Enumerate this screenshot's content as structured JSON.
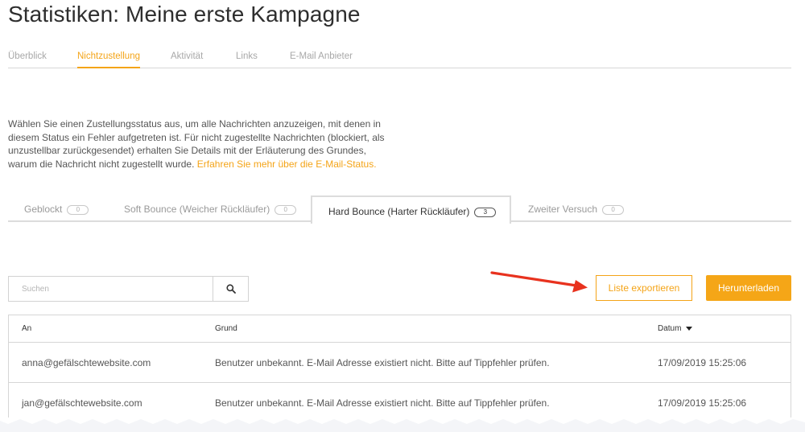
{
  "page": {
    "title": "Statistiken: Meine erste Kampagne"
  },
  "nav": {
    "tabs": [
      {
        "label": "Überblick"
      },
      {
        "label": "Nichtzustellung"
      },
      {
        "label": "Aktivität"
      },
      {
        "label": "Links"
      },
      {
        "label": "E-Mail Anbieter"
      }
    ],
    "active": "Nichtzustellung"
  },
  "intro": {
    "text": "Wählen Sie einen Zustellungsstatus aus, um alle Nachrichten anzuzeigen, mit denen in diesem Status ein Fehler aufgetreten ist. Für nicht zugestellte Nachrichten (blockiert, als unzustellbar zurückgesendet) erhalten Sie Details mit der Erläuterung des Grundes, warum die Nachricht nicht zugestellt wurde.",
    "link": "Erfahren Sie mehr über die E-Mail-Status."
  },
  "status_tabs": [
    {
      "label": "Geblockt",
      "count": "0"
    },
    {
      "label": "Soft Bounce (Weicher Rückläufer)",
      "count": "0"
    },
    {
      "label": "Hard Bounce (Harter Rückläufer)",
      "count": "3"
    },
    {
      "label": "Zweiter Versuch",
      "count": "0"
    }
  ],
  "active_status": "Hard Bounce (Harter Rückläufer)",
  "search": {
    "placeholder": "Suchen",
    "value": "",
    "icon": "search-icon"
  },
  "actions": {
    "export_label": "Liste exportieren",
    "download_label": "Herunterladen"
  },
  "annotation": {
    "icon": "red-arrow",
    "color": "#e8321e"
  },
  "table": {
    "columns": {
      "to": "An",
      "reason": "Grund",
      "date": "Datum"
    },
    "sort": "descending",
    "rows": [
      {
        "to": "anna@gefälschtewebsite.com",
        "reason": "Benutzer unbekannt. E-Mail Adresse existiert nicht. Bitte auf Tippfehler prüfen.",
        "date": "17/09/2019 15:25:06"
      },
      {
        "to": "jan@gefälschtewebsite.com",
        "reason": "Benutzer unbekannt. E-Mail Adresse existiert nicht. Bitte auf Tippfehler prüfen.",
        "date": "17/09/2019 15:25:06"
      }
    ]
  },
  "colors": {
    "accent": "#f4a418",
    "border": "#d6d6d6",
    "text": "#333333"
  }
}
